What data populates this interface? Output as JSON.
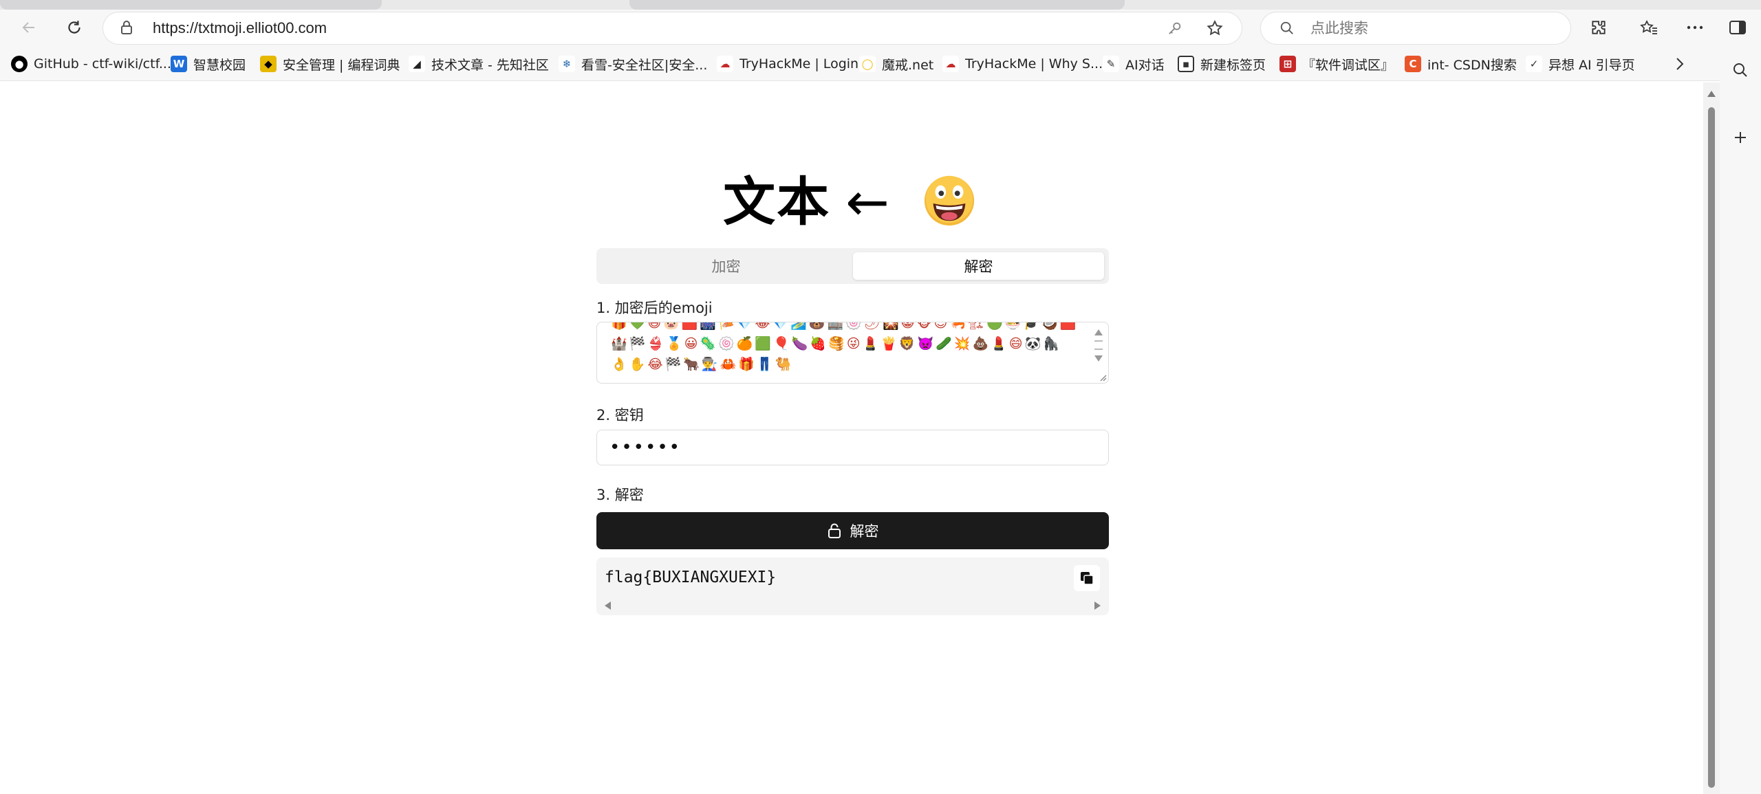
{
  "browser": {
    "url": "https://txtmoji.elliot00.com",
    "search_placeholder": "点此搜索",
    "icons": [
      "back-icon",
      "reload-icon",
      "lock-icon",
      "key-icon",
      "star-icon",
      "search-icon",
      "extensions-icon",
      "favorites-icon",
      "more-icon",
      "sidebar-icon"
    ]
  },
  "bookmarks": [
    {
      "label": "GitHub - ctf-wiki/ctf...",
      "icon": "github-icon",
      "color": "#000000"
    },
    {
      "label": "智慧校园",
      "icon": "campus-icon",
      "color": "#1e6fd9"
    },
    {
      "label": "安全管理 | 编程词典",
      "icon": "dictionary-icon",
      "color": "#e6b800"
    },
    {
      "label": "技术文章 - 先知社区",
      "icon": "xianzhi-icon",
      "color": "#222222"
    },
    {
      "label": "看雪-安全社区|安全...",
      "icon": "snowflake-icon",
      "color": "#2b6cb0"
    },
    {
      "label": "TryHackMe | Login",
      "icon": "tryhackme-icon",
      "color": "#c62828"
    },
    {
      "label": "魔戒.net",
      "icon": "ring-icon",
      "color": "#f2b705"
    },
    {
      "label": "TryHackMe | Why S...",
      "icon": "tryhackme-icon",
      "color": "#c62828"
    },
    {
      "label": "AI对话",
      "icon": "ai-icon",
      "color": "#333333"
    },
    {
      "label": "新建标签页",
      "icon": "newtab-icon",
      "color": "#333333"
    },
    {
      "label": "『软件调试区』",
      "icon": "debug-icon",
      "color": "#c62828"
    },
    {
      "label": "int- CSDN搜索",
      "icon": "csdn-icon",
      "color": "#e8562a"
    },
    {
      "label": "异想 AI 引导页",
      "icon": "yixiang-icon",
      "color": "#333333"
    }
  ],
  "app": {
    "title_text": "文本",
    "title_arrow": "←",
    "tabs": [
      "加密",
      "解密"
    ],
    "active_tab": "解密",
    "step1_label": "1. 加密后的emoji",
    "emoji_content": "🎁💚😄🐷🟥🎆🎏💎😂💎🏄🐻🏬🍥🌶🎇😸🐵😊🦐🏗🟢🍜🎓🥥🟥🏰🏁👙🏅😀🦠🍥🍊🟩🎈🍆🍓🥞😜💄🍟🦁👿🥒💥💩💄😄🐼🦍👌✋😂🏁🐂👨‍🏭🦀🎁👖🐫",
    "step2_label": "2. 密钥",
    "key_value": "••••••",
    "step3_label": "3. 解密",
    "decrypt_button": "解密",
    "result": "flag{BUXIANGXUEXI}",
    "colors": {
      "button_bg": "#1b1b1b",
      "tab_bg": "#f1f1f2",
      "result_bg": "#f4f4f5"
    }
  }
}
